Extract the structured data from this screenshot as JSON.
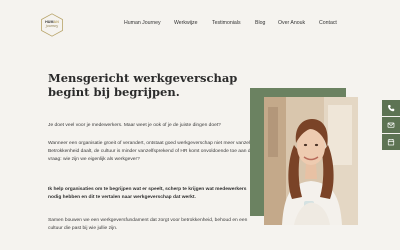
{
  "header": {
    "logo": {
      "line1_a": "HUM",
      "line1_b": "AN",
      "line2": "journey"
    },
    "nav": [
      {
        "label": "Human Journey"
      },
      {
        "label": "Werkwijze"
      },
      {
        "label": "Testimonials"
      },
      {
        "label": "Blog"
      },
      {
        "label": "Over Anouk"
      },
      {
        "label": "Contact"
      }
    ]
  },
  "main": {
    "title": "Mensgericht werkgeverschap begint bij begrijpen.",
    "paragraphs": [
      "Je doet veel voor je medewerkers. Maar weet je ook of je de juiste dingen doet?",
      "Wanneer een organisatie groeit of verandert, ontstaat goed werkgeverschap niet meer vanzelf. Betrokkenheid daalt, de cultuur is minder vanzelfsprekend of HR komt onvoldoende toe aan de vraag: wie zijn we eigenlijk als werkgever?",
      "Ik help organisaties om te begrijpen wat er speelt, scherp te krijgen wat medewerkers nodig hebben en dit te vertalen naar werkgeverschap dat werkt.",
      "Samen bouwen we een werkgeversfundament dat zorgt voor betrokkenheid, behoud en een cultuur die past bij wie jullie zijn."
    ]
  },
  "side_actions": [
    {
      "icon": "phone-icon"
    },
    {
      "icon": "mail-icon"
    },
    {
      "icon": "calendar-icon"
    }
  ],
  "colors": {
    "background": "#f5f3ef",
    "accent_green": "#5d7353",
    "frame_green": "#6b8261",
    "logo_gold": "#b8a46a"
  }
}
